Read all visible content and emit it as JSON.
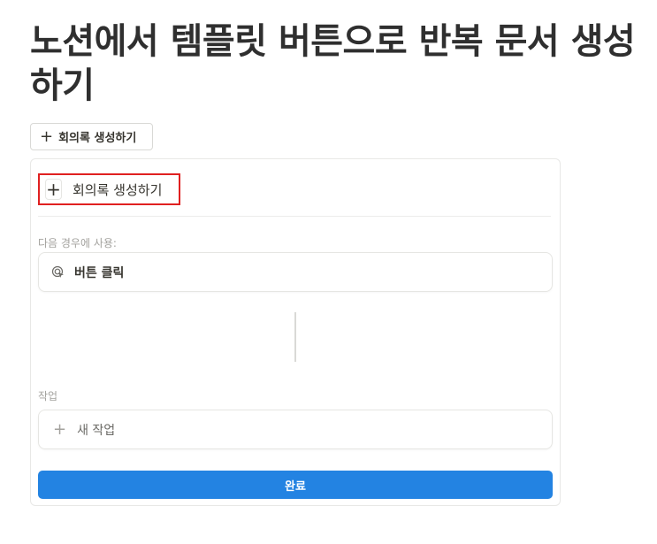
{
  "page": {
    "title": "노션에서 템플릿 버튼으로 반복 문서 생성하기"
  },
  "button_block": {
    "label": "회의록 생성하기",
    "icon": "plus-icon"
  },
  "editor": {
    "name_value": "회의록 생성하기",
    "name_icon": "plus-icon",
    "trigger_section_label": "다음 경우에 사용:",
    "trigger_label": "버튼 클릭",
    "trigger_icon": "cursor-click-icon",
    "action_section_label": "작업",
    "new_action_label": "새 작업",
    "new_action_icon": "plus-icon",
    "done_label": "완료",
    "accent_color": "#2383e2",
    "highlight_color": "#e02020"
  }
}
